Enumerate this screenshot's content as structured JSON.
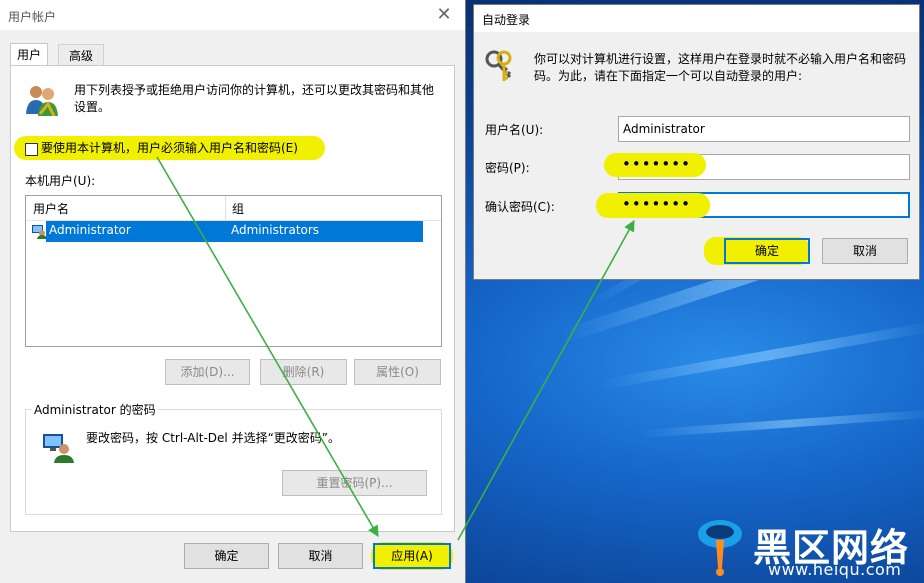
{
  "main_dialog": {
    "title": "用户帐户",
    "tabs": [
      {
        "label": "用户"
      },
      {
        "label": "高级"
      }
    ],
    "intro_line1": "用下列表授予或拒绝用户访问你的计算机，还可以更改其密码和其他",
    "intro_line2": "设置。",
    "checkbox_label": "要使用本计算机，用户必须输入用户名和密码(E)",
    "users_label": "本机用户(U):",
    "columns": {
      "username": "用户名",
      "group": "组"
    },
    "rows": [
      {
        "username": "Administrator",
        "group": "Administrators"
      }
    ],
    "add_button": "添加(D)...",
    "delete_button": "删除(R)",
    "properties_button": "属性(O)",
    "password_group_label": "Administrator 的密码",
    "password_hint": "要改密码，按 Ctrl-Alt-Del 并选择“更改密码”。",
    "reset_password_button": "重置密码(P)...",
    "ok_button": "确定",
    "cancel_button": "取消",
    "apply_button": "应用(A)"
  },
  "autologon_dialog": {
    "title": "自动登录",
    "description_line1": "你可以对计算机进行设置，这样用户在登录时就不必输入用户名和密码",
    "description_line2": "码。为此，请在下面指定一个可以自动登录的用户:",
    "username_label": "用户名(U):",
    "username_value": "Administrator",
    "password_label": "密码(P):",
    "password_value": "•••••••",
    "confirm_label": "确认密码(C):",
    "confirm_value": "•••••••",
    "ok_button": "确定",
    "cancel_button": "取消"
  },
  "watermark": {
    "brand": "黑区网络",
    "url": "www.heiqu.com"
  },
  "colors": {
    "highlight": "#f0f000",
    "selection": "#0078d7",
    "arrow": "#3cb043",
    "desktop": "#0b3f8f"
  }
}
